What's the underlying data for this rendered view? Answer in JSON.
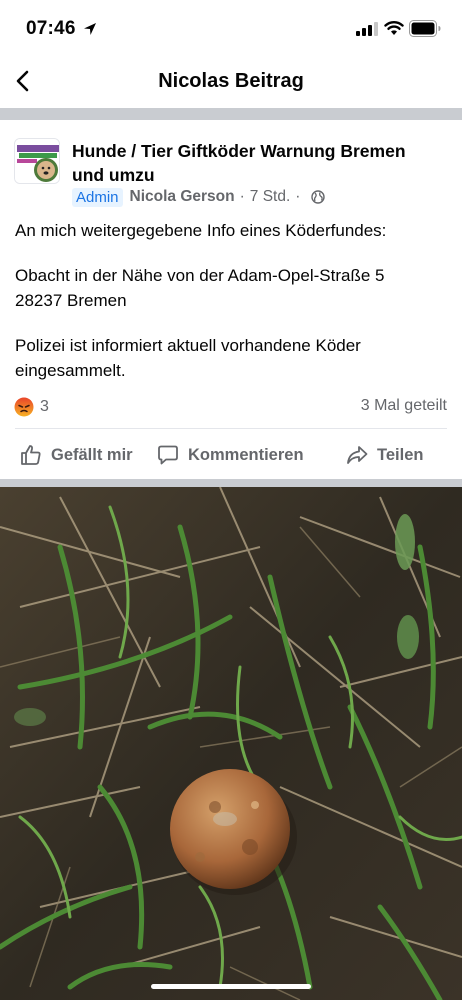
{
  "status_bar": {
    "time": "07:46"
  },
  "header": {
    "title": "Nicolas Beitrag"
  },
  "post": {
    "group_name": "Hunde / Tier Giftköder Warnung Bremen und umzu",
    "badge": "Admin",
    "author": "Nicola Gerson",
    "separator": "·",
    "time": "7 Std.",
    "paragraphs": [
      "An mich weitergegebene Info eines Köderfundes:",
      "Obacht in der Nähe von der Adam-Opel-Straße 5\n28237 Bremen",
      "Polizei ist informiert aktuell vorhandene Köder eingesammelt."
    ],
    "reaction_count": "3",
    "shares": "3 Mal geteilt"
  },
  "actions": {
    "like": "Gefällt mir",
    "comment": "Kommentieren",
    "share": "Teilen"
  },
  "colors": {
    "meta_gray": "#65676b",
    "admin_blue": "#1b74e4",
    "divider": "#c9ccd1"
  },
  "icons": [
    "location-arrow-icon",
    "signal-icon",
    "wifi-icon",
    "battery-icon",
    "chevron-left-icon",
    "globe-icon",
    "angry-reaction-icon",
    "thumbs-up-icon",
    "comment-icon",
    "share-arrow-icon"
  ]
}
